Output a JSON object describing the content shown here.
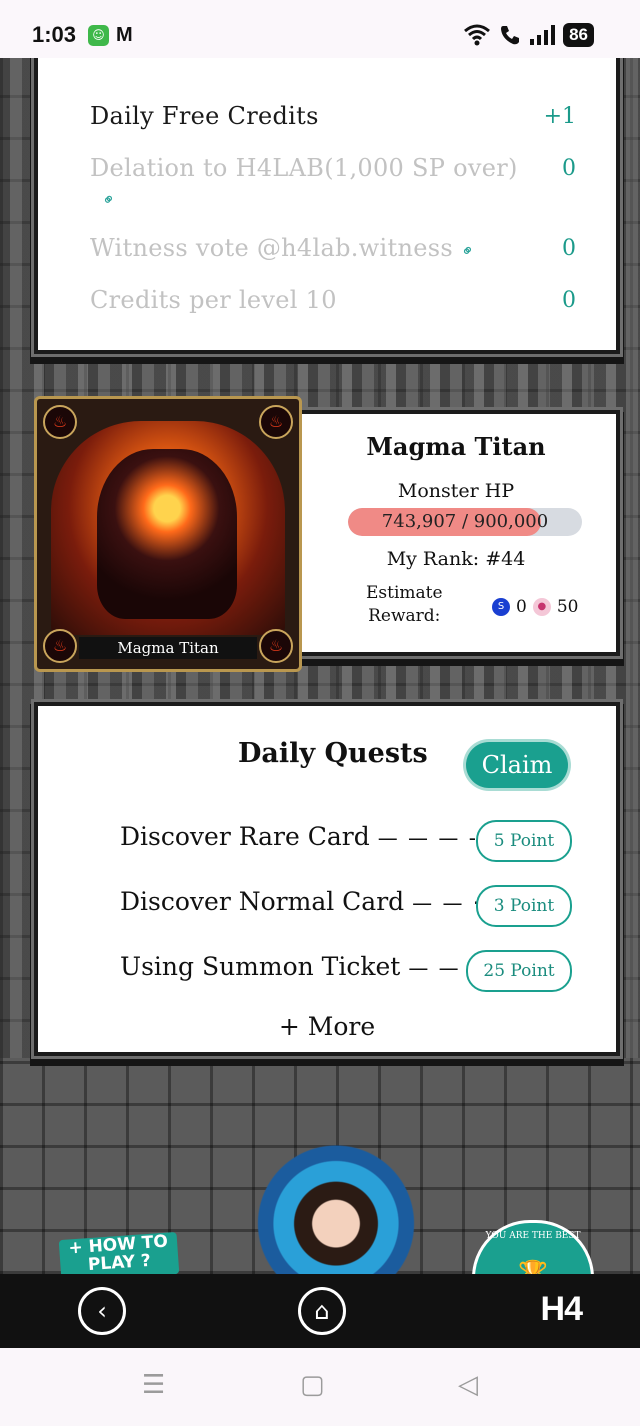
{
  "status_bar": {
    "time": "1:03",
    "mail_icon": "M",
    "battery": "86"
  },
  "credits_panel": {
    "rows": [
      {
        "label": "Daily Free Credits",
        "value": "+1",
        "has_link": false
      },
      {
        "label": "Delation to H4LAB(1,000 SP over)",
        "value": "0",
        "has_link": true
      },
      {
        "label": "Witness vote @h4lab.witness",
        "value": "0",
        "has_link": true
      },
      {
        "label": "Credits per level 10",
        "value": "0",
        "has_link": false
      }
    ]
  },
  "boss": {
    "card_name": "Magma Titan",
    "title": "Magma Titan",
    "hp_label": "Monster HP",
    "hp_text": "743,907 / 900,000",
    "hp_current": 743907,
    "hp_max": 900000,
    "rank_text": "My Rank: #44",
    "reward_label_line1": "Estimate",
    "reward_label_line2": "Reward:",
    "reward_steem": "0",
    "reward_token": "50"
  },
  "quests": {
    "title": "Daily Quests",
    "claim_label": "Claim",
    "items": [
      {
        "label": "Discover Rare Card",
        "dashes": "— — — -",
        "points": "5 Point"
      },
      {
        "label": "Discover Normal Card",
        "dashes": "— — ·",
        "points": "3 Point"
      },
      {
        "label": "Using Summon Ticket",
        "dashes": "— —",
        "points": "25 Point"
      }
    ],
    "more_label": "+ More"
  },
  "bottom": {
    "how_to_play": "+ HOW TO PLAY ?",
    "trophy_text": "YOU ARE THE BEST"
  },
  "nav": {
    "logo": "H4"
  },
  "colors": {
    "accent": "#1aa08f",
    "hp_fill": "#f08a86",
    "hp_track": "#d7dbe1"
  }
}
